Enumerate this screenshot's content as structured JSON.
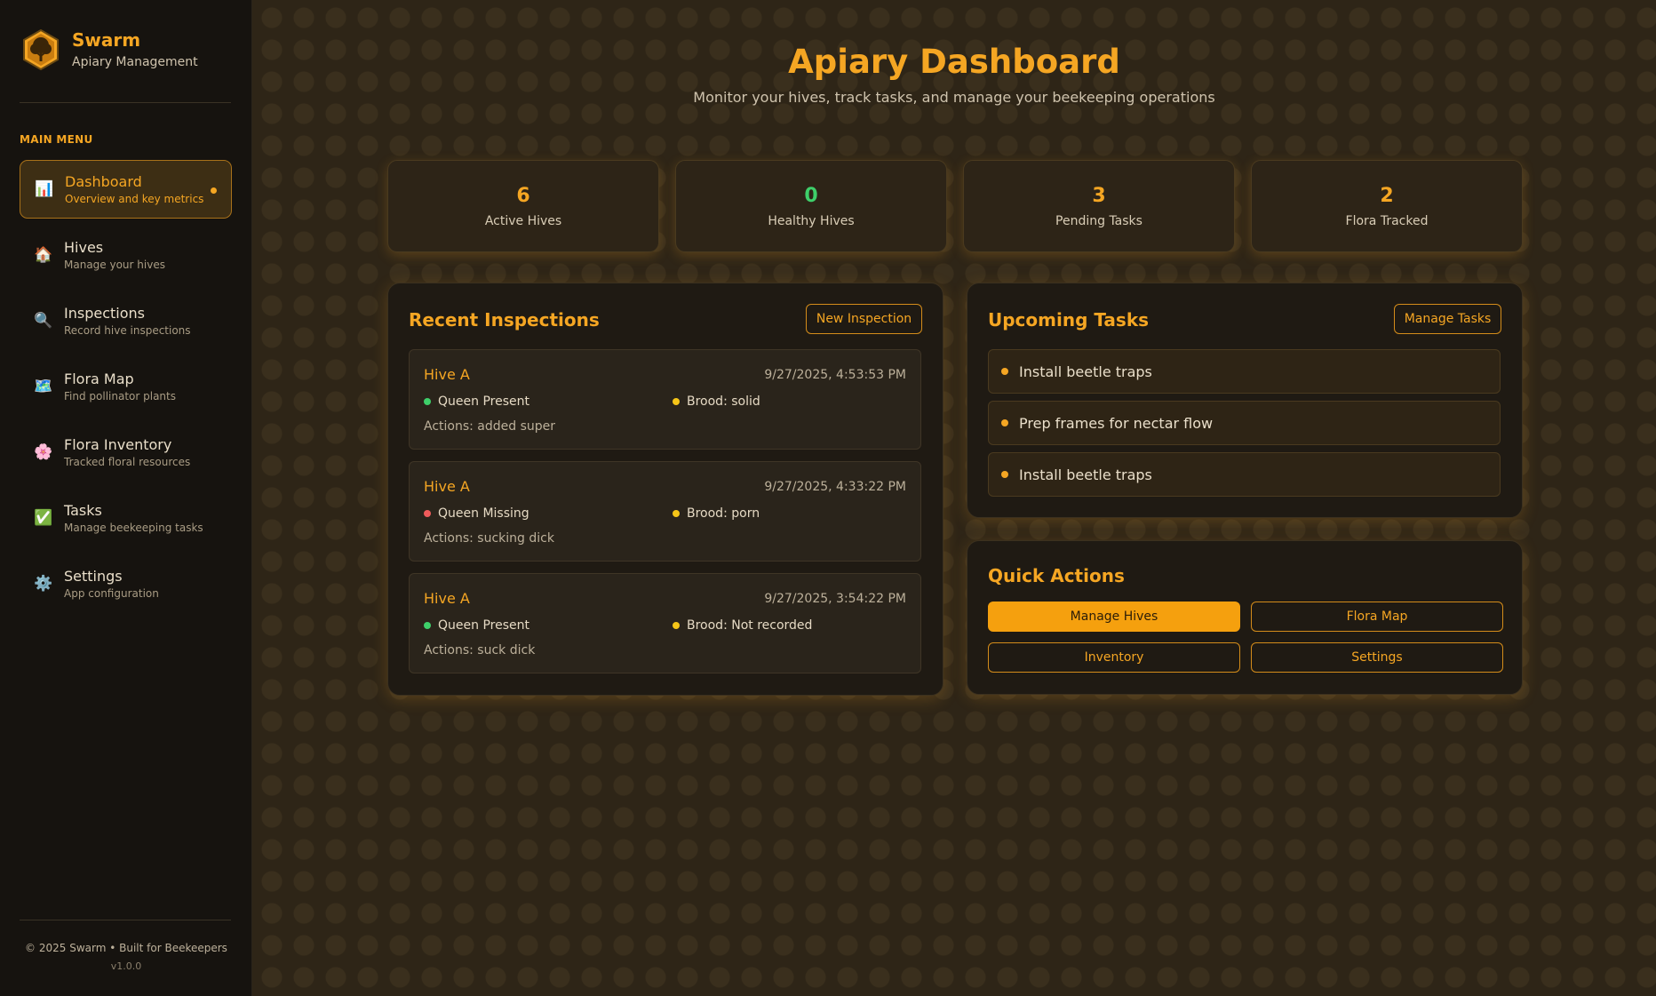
{
  "brand": {
    "name": "Swarm",
    "subtitle": "Apiary Management"
  },
  "sidebar": {
    "menu_label": "MAIN MENU",
    "items": [
      {
        "icon": "bar-chart-icon",
        "glyph": "📊",
        "title": "Dashboard",
        "desc": "Overview and key metrics",
        "active": true
      },
      {
        "icon": "house-icon",
        "glyph": "🏠",
        "title": "Hives",
        "desc": "Manage your hives"
      },
      {
        "icon": "magnifier-icon",
        "glyph": "🔍",
        "title": "Inspections",
        "desc": "Record hive inspections"
      },
      {
        "icon": "map-icon",
        "glyph": "🗺️",
        "title": "Flora Map",
        "desc": "Find pollinator plants"
      },
      {
        "icon": "blossom-icon",
        "glyph": "🌸",
        "title": "Flora Inventory",
        "desc": "Tracked floral resources"
      },
      {
        "icon": "checkmark-icon",
        "glyph": "✅",
        "title": "Tasks",
        "desc": "Manage beekeeping tasks"
      },
      {
        "icon": "gear-icon",
        "glyph": "⚙️",
        "title": "Settings",
        "desc": "App configuration"
      }
    ],
    "footer": "© 2025 Swarm • Built for Beekeepers",
    "version": "v1.0.0"
  },
  "header": {
    "title": "Apiary Dashboard",
    "subtitle": "Monitor your hives, track tasks, and manage your beekeeping operations"
  },
  "stats": [
    {
      "value": "6",
      "label": "Active Hives",
      "color": "#f5a623"
    },
    {
      "value": "0",
      "label": "Healthy Hives",
      "color": "#3ecf6a"
    },
    {
      "value": "3",
      "label": "Pending Tasks",
      "color": "#f5a623"
    },
    {
      "value": "2",
      "label": "Flora Tracked",
      "color": "#f5a623"
    }
  ],
  "inspections": {
    "title": "Recent Inspections",
    "button": "New Inspection",
    "items": [
      {
        "hive": "Hive A",
        "date": "9/27/2025, 4:53:53 PM",
        "queen": "Queen Present",
        "queen_color": "#3ecf6a",
        "brood": "Brood: solid",
        "actions": "Actions: added super"
      },
      {
        "hive": "Hive A",
        "date": "9/27/2025, 4:33:22 PM",
        "queen": "Queen Missing",
        "queen_color": "#ef5b5b",
        "brood": "Brood: porn",
        "actions": "Actions: sucking dick"
      },
      {
        "hive": "Hive A",
        "date": "9/27/2025, 3:54:22 PM",
        "queen": "Queen Present",
        "queen_color": "#3ecf6a",
        "brood": "Brood: Not recorded",
        "actions": "Actions: suck dick"
      }
    ]
  },
  "tasks": {
    "title": "Upcoming Tasks",
    "button": "Manage Tasks",
    "items": [
      "Install beetle traps",
      "Prep frames for nectar flow",
      "Install beetle traps"
    ]
  },
  "quick_actions": {
    "title": "Quick Actions",
    "buttons": [
      "Manage Hives",
      "Flora Map",
      "Inventory",
      "Settings"
    ]
  },
  "colors": {
    "accent": "#f5a623",
    "brood_dot": "#f5c518"
  }
}
